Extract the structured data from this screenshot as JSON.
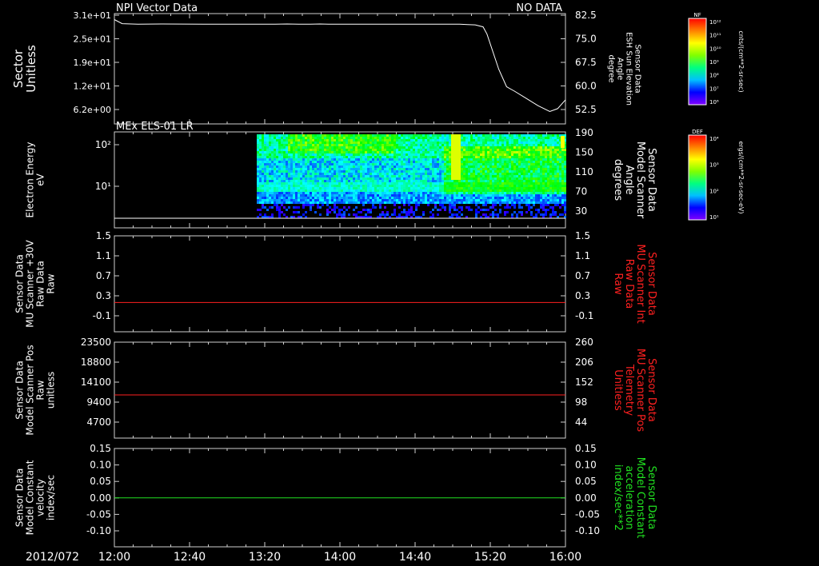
{
  "date": "2012/072",
  "time_ticks": [
    "12:00",
    "12:40",
    "13:20",
    "14:00",
    "14:40",
    "15:20",
    "16:00"
  ],
  "colors": {
    "white": "#ffffff",
    "red": "#ff2020",
    "green": "#20e020",
    "background": "#000000"
  },
  "colorbars": [
    {
      "top_label": "NF",
      "unit": "cnts/(cm**2-sr-sec)",
      "ticks": [
        "10¹²",
        "10¹¹",
        "10¹⁰",
        "10⁹",
        "10⁸",
        "10⁷",
        "10⁶"
      ]
    },
    {
      "top_label": "DEF",
      "unit": "ergs/(cm**2-sr-sec-eV)",
      "ticks": [
        "10⁴",
        "10³",
        "10²",
        "10¹"
      ]
    }
  ],
  "chart_data": [
    {
      "type": "line",
      "title": "NPI Vector Data",
      "title_right": "NO DATA",
      "left_label": [
        "Sector",
        "Unitless"
      ],
      "left_ticks": [
        "3.1e+01",
        "2.5e+01",
        "1.9e+01",
        "1.2e+01",
        "6.2e+00"
      ],
      "right_label": [
        "Sensor Data",
        "ESH Sun Elevation",
        "Angle",
        "degree"
      ],
      "right_ticks": [
        "82.5",
        "75.0",
        "67.5",
        "60.0",
        "52.5"
      ],
      "ylim": [
        48,
        82.5
      ],
      "x": [
        0,
        10,
        30,
        60,
        120,
        180,
        205,
        220,
        235,
        250,
        262,
        273,
        282,
        290,
        300,
        310,
        320,
        330,
        340,
        350,
        360,
        370,
        380,
        390,
        400,
        410,
        420,
        430,
        440,
        450,
        460,
        470,
        475,
        485,
        490,
        500,
        510,
        525,
        540,
        555,
        565,
        575
      ],
      "y": [
        81,
        79.6,
        79.4,
        79.5,
        79.4,
        79.4,
        79.4,
        79.5,
        79.4,
        79.4,
        79.5,
        79.4,
        79.4,
        79.4,
        79.4,
        79.4,
        79.4,
        79.4,
        79.4,
        79.4,
        79.4,
        79.4,
        79.4,
        79.4,
        79.4,
        79.4,
        79.4,
        79.4,
        79.4,
        79.3,
        79.2,
        78.5,
        76,
        68,
        64,
        58,
        56.5,
        54,
        51.5,
        49.5,
        50.5,
        53.5
      ]
    },
    {
      "type": "heatmap",
      "title": "MEx ELS-01 LR",
      "left_label": [
        "Electron Energy",
        "eV"
      ],
      "left_ticks": [
        "10²",
        "10¹"
      ],
      "right_label": [
        "Sensor Data",
        "Model Scanner",
        "Angle",
        "degrees"
      ],
      "right_ticks": [
        "190",
        "150",
        "110",
        "70",
        "30"
      ]
    },
    {
      "type": "line",
      "left_label": [
        "Sensor Data",
        "MU Scanner +30V",
        "Raw Data",
        "Raw"
      ],
      "left_ticks": [
        "1.5",
        "1.1",
        "0.7",
        "0.3",
        "-0.1"
      ],
      "right_label": [
        "Sensor Data",
        "MU Scanner Int",
        "Raw Data",
        "Raw"
      ],
      "right_ticks": [
        "1.5",
        "1.1",
        "0.7",
        "0.3",
        "-0.1"
      ],
      "ylim": [
        -0.3,
        1.5
      ],
      "value": 0,
      "line_color": "red"
    },
    {
      "type": "line",
      "left_label": [
        "Sensor Data",
        "Model Scanner Pos",
        "Raw",
        "unitless"
      ],
      "left_ticks": [
        "23500",
        "18800",
        "14100",
        "9400",
        "4700"
      ],
      "right_label": [
        "Sensor Data",
        "MU Scanner Pos",
        "Telemetry",
        "Unitless"
      ],
      "right_ticks": [
        "260",
        "206",
        "152",
        "98",
        "44"
      ],
      "ylim": [
        0,
        23500
      ],
      "value": 8000,
      "line_color": "red"
    },
    {
      "type": "line",
      "left_label": [
        "Sensor Data",
        "Model Constant",
        "velocity",
        "index/sec"
      ],
      "left_ticks": [
        "0.15",
        "0.10",
        "0.05",
        "0.00",
        "-0.05",
        "-0.10"
      ],
      "right_label": [
        "Sensor Data",
        "Model Constant",
        "acceleration",
        "index/sec**2"
      ],
      "right_ticks": [
        "0.15",
        "0.10",
        "0.05",
        "0.00",
        "-0.05",
        "-0.10"
      ],
      "ylim": [
        -0.1,
        0.15
      ],
      "value": 0.0,
      "line_color": "green"
    }
  ]
}
